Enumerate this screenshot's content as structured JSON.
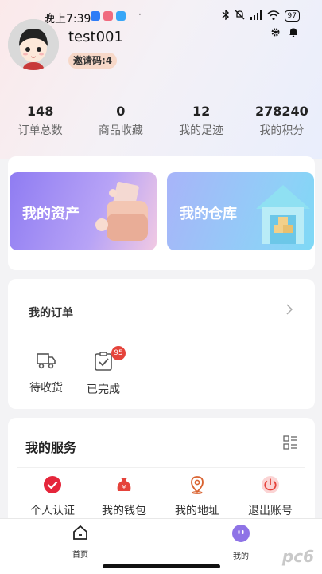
{
  "status_bar": {
    "time": "晚上7:39",
    "dot": "·",
    "battery": "97"
  },
  "profile": {
    "username": "test001",
    "invite_code": "邀请码:4"
  },
  "stats": [
    {
      "value": "148",
      "label": "订单总数"
    },
    {
      "value": "0",
      "label": "商品收藏"
    },
    {
      "value": "12",
      "label": "我的足迹"
    },
    {
      "value": "278240",
      "label": "我的积分"
    }
  ],
  "assets": {
    "my_assets": "我的资产",
    "my_warehouse": "我的仓库"
  },
  "orders": {
    "title": "我的订单",
    "items": [
      {
        "label": "待收货"
      },
      {
        "label": "已完成",
        "badge": "95"
      }
    ]
  },
  "services": {
    "title": "我的服务",
    "items": [
      {
        "label": "个人认证",
        "icon": "check-circle-icon"
      },
      {
        "label": "我的钱包",
        "icon": "wallet-icon"
      },
      {
        "label": "我的地址",
        "icon": "location-icon"
      },
      {
        "label": "退出账号",
        "icon": "power-icon"
      }
    ]
  },
  "tabbar": {
    "home": "首页",
    "mine": "我的"
  },
  "watermark": "pc6",
  "colors": {
    "accent": "#8f7cf2",
    "badge": "#e5433b",
    "service_red": "#e5433b"
  }
}
